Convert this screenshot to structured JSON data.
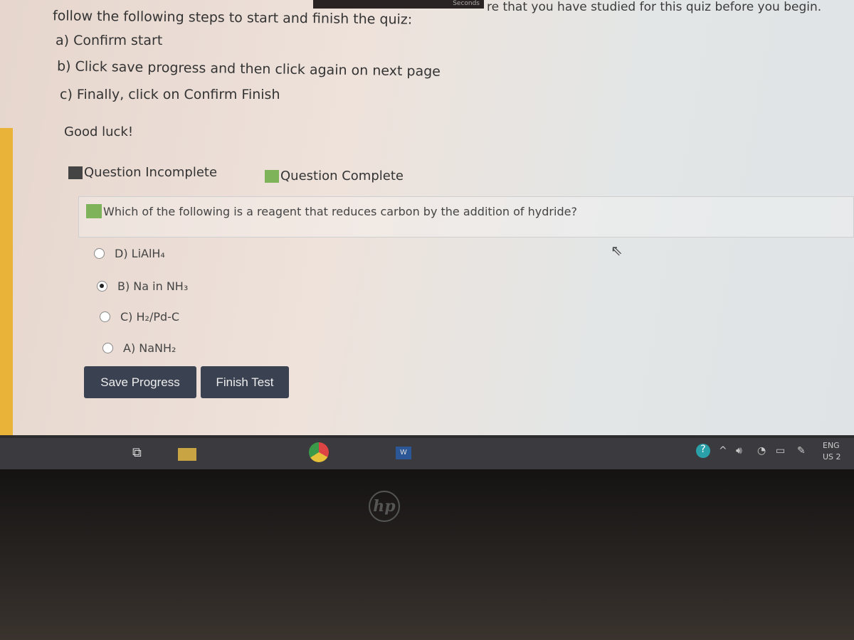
{
  "header": {
    "timer_label": "Seconds",
    "note": "re that you have studied for this quiz before you begin."
  },
  "instructions": {
    "intro": "follow the following steps to start and finish the quiz:",
    "steps": [
      "a) Confirm start",
      "b) Click save progress and then click again on next page",
      "c) Finally, click on Confirm Finish"
    ],
    "closing": "Good luck!"
  },
  "legend": [
    {
      "label": "Question Incomplete",
      "color": "#444444"
    },
    {
      "label": "Question Complete",
      "color": "#7fb35a"
    }
  ],
  "question": {
    "text": "Which of the following is a reagent that reduces carbon by the addition of hydride?",
    "status_color": "#7fb35a",
    "options": [
      {
        "label": "D)  LiAlH₄",
        "selected": false
      },
      {
        "label": "B)  Na in NH₃",
        "selected": true
      },
      {
        "label": "C)  H₂/Pd-C",
        "selected": false
      },
      {
        "label": "A)  NaNH₂",
        "selected": false
      }
    ]
  },
  "buttons": {
    "save": "Save Progress",
    "finish": "Finish Test"
  },
  "taskbar": {
    "lang": "ENG",
    "region": "US",
    "clock_partial": "2"
  },
  "bezel": {
    "logo": "hp"
  }
}
